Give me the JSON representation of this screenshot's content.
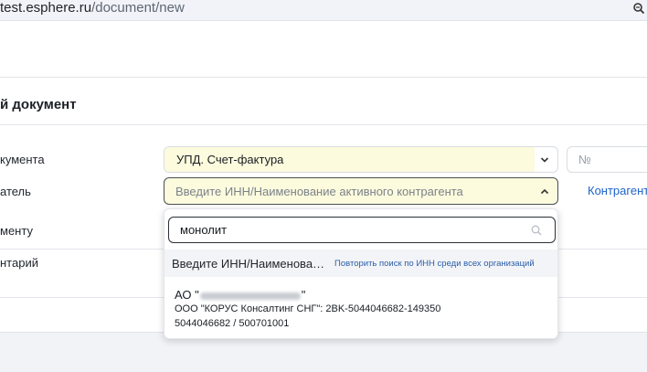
{
  "browser": {
    "url_host": "test.esphere.ru",
    "url_path": "/document/new"
  },
  "page": {
    "title": "й документ"
  },
  "form": {
    "doctype_label": "кумента",
    "doctype_value": "УПД. Счет-фактура",
    "number_placeholder": "№",
    "recipient_label": "атель",
    "recipient_placeholder": "Введите ИНН/Наименование активного контрагента",
    "contragent_link": "Контрагент",
    "document_label": "менту",
    "comment_label": "нтарий"
  },
  "dropdown": {
    "search_value": "монолит",
    "hint": "Введите ИНН/Наименова…",
    "repeat_search_link": "Повторить поиск по ИНН среди всех организаций",
    "results": [
      {
        "name_prefix": "АО \"",
        "name_suffix": "\"",
        "operator": "ООО \"КОРУС Консалтинг СНГ\": 2BK-5044046682-149350",
        "inn": "5044046682 / 500701001"
      }
    ]
  }
}
